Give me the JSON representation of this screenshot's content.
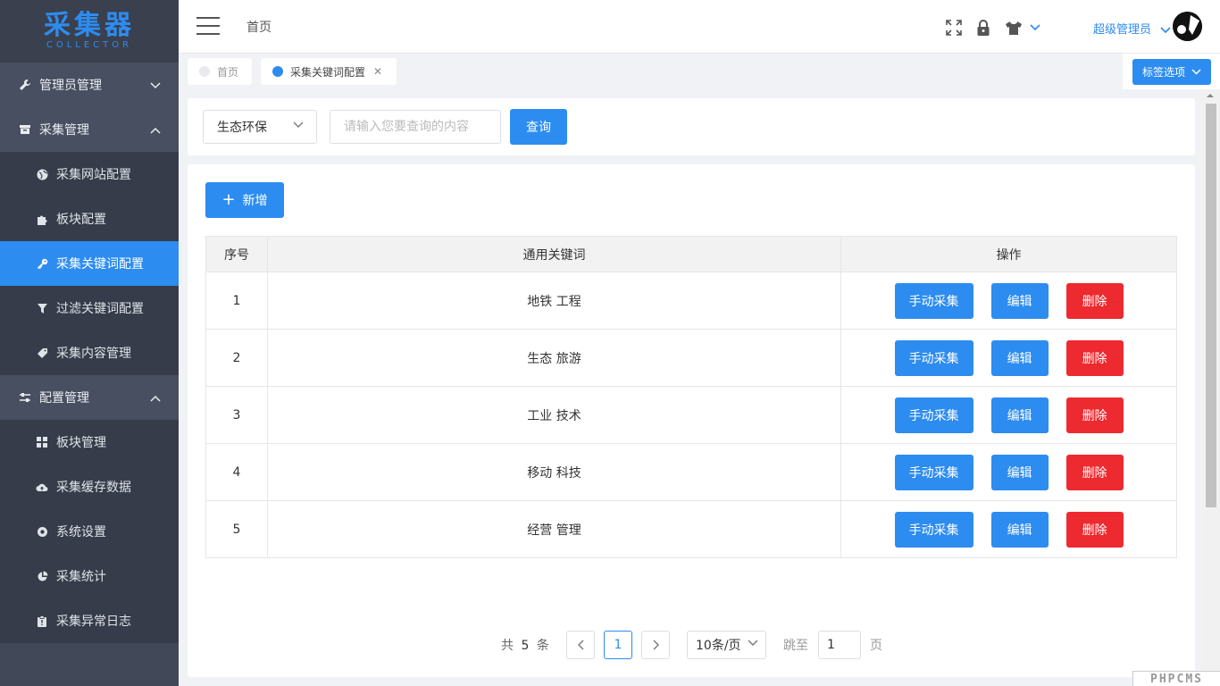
{
  "logo": {
    "title": "采集器",
    "subtitle": "COLLECTOR"
  },
  "sidebar": {
    "groups": [
      {
        "label": "管理员管理",
        "icon": "wrench-icon",
        "expanded": false,
        "items": []
      },
      {
        "label": "采集管理",
        "icon": "inbox-icon",
        "expanded": true,
        "items": [
          {
            "label": "采集网站配置",
            "icon": "globe-icon"
          },
          {
            "label": "板块配置",
            "icon": "puzzle-icon"
          },
          {
            "label": "采集关键词配置",
            "icon": "key-icon",
            "active": true
          },
          {
            "label": "过滤关键词配置",
            "icon": "filter-icon"
          },
          {
            "label": "采集内容管理",
            "icon": "tag-icon"
          }
        ]
      },
      {
        "label": "配置管理",
        "icon": "sliders-icon",
        "expanded": true,
        "items": [
          {
            "label": "板块管理",
            "icon": "grid-icon"
          },
          {
            "label": "采集缓存数据",
            "icon": "cloud-upload-icon"
          },
          {
            "label": "系统设置",
            "icon": "gear-icon"
          },
          {
            "label": "采集统计",
            "icon": "pie-chart-icon"
          },
          {
            "label": "采集异常日志",
            "icon": "clipboard-icon"
          }
        ]
      }
    ]
  },
  "header": {
    "breadcrumb": "首页",
    "user_name": "超级管理员",
    "icons": [
      "expand-icon",
      "lock-icon",
      "tshirt-icon",
      "chevron-down-icon"
    ]
  },
  "tabs": {
    "home": "首页",
    "active": "采集关键词配置",
    "options": "标签选项"
  },
  "search": {
    "category": "生态环保",
    "placeholder": "请输入您要查询的内容",
    "button": "查询"
  },
  "toolbar": {
    "add": "新增"
  },
  "table": {
    "headers": [
      "序号",
      "通用关键词",
      "操作"
    ],
    "rows": [
      {
        "index": "1",
        "keyword": "地铁 工程"
      },
      {
        "index": "2",
        "keyword": "生态 旅游"
      },
      {
        "index": "3",
        "keyword": "工业 技术"
      },
      {
        "index": "4",
        "keyword": "移动 科技"
      },
      {
        "index": "5",
        "keyword": "经营 管理"
      }
    ],
    "actions": {
      "collect": "手动采集",
      "edit": "编辑",
      "delete": "删除"
    }
  },
  "pagination": {
    "total_prefix": "共",
    "total": "5",
    "total_suffix": "条",
    "current_page": "1",
    "page_size": "10条/页",
    "jump_label": "跳至",
    "jump_value": "1",
    "page_label": "页"
  },
  "watermark": "PHPCMS",
  "colors": {
    "primary": "#2d8cf0",
    "danger": "#ed2a2f",
    "sidebar": "#414858",
    "sidebar_sub": "#363c49"
  }
}
